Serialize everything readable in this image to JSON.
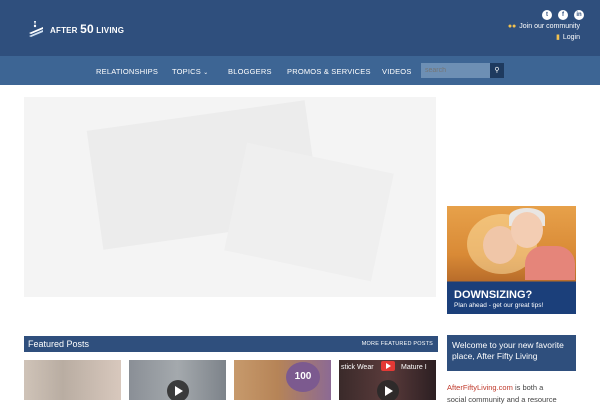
{
  "header": {
    "logo_prefix": "AFTER",
    "logo_number": "50",
    "logo_suffix": "LIVING",
    "social_icons": [
      "twitter-icon",
      "facebook-icon",
      "linkedin-icon"
    ],
    "join_label": "Join our community",
    "login_label": "Login"
  },
  "nav": {
    "items": [
      "RELATIONSHIPS",
      "TOPICS",
      "BLOGGERS",
      "PROMOS & SERVICES",
      "VIDEOS"
    ],
    "search_placeholder": "search"
  },
  "ad": {
    "title": "DOWNSIZING?",
    "subtitle": "Plan ahead - get our great tips!"
  },
  "featured": {
    "title": "Featured Posts",
    "more_label": "MORE FEATURED POSTS",
    "thumb3_badge": "100",
    "thumb4_left": "stick Wear",
    "thumb4_right": "Mature I"
  },
  "welcome": {
    "heading": "Welcome to your new favorite place, After Fifty Living",
    "link": "AfterFiftyLiving.com",
    "body_line1": " is both a",
    "body_line2": "social community and a resource"
  },
  "colors": {
    "header_bg": "#2f4f7d",
    "nav_bg": "#3d6594",
    "accent_link": "#c0392b",
    "login_icon": "#f2c14e"
  }
}
